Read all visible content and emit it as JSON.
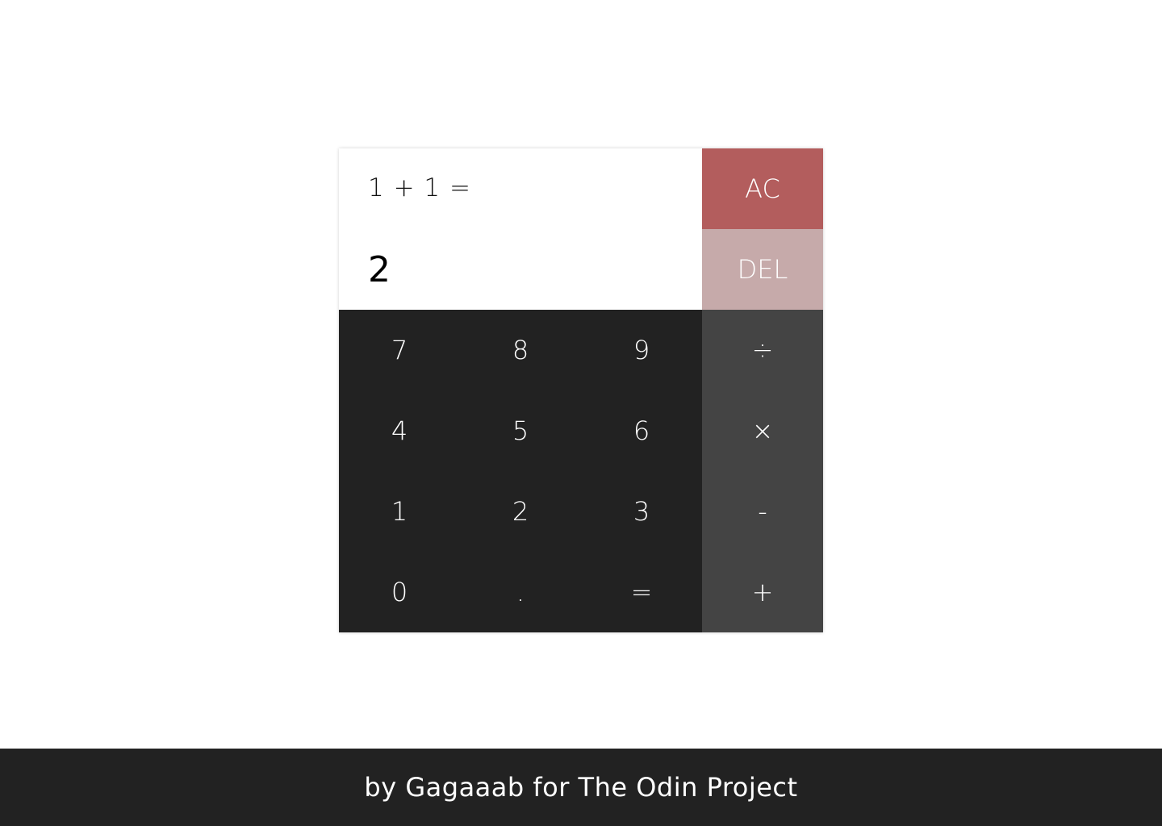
{
  "display": {
    "previous": "1 + 1 =",
    "current": "2"
  },
  "keys": {
    "ac": "AC",
    "del": "DEL",
    "seven": "7",
    "eight": "8",
    "nine": "9",
    "divide": "÷",
    "four": "4",
    "five": "5",
    "six": "6",
    "multiply": "×",
    "one": "1",
    "two": "2",
    "three": "3",
    "subtract": "-",
    "zero": "0",
    "decimal": ".",
    "equals": "=",
    "add": "+"
  },
  "footer": {
    "text": "by Gagaaab for The Odin Project"
  },
  "colors": {
    "number_key_bg": "#222222",
    "operator_key_bg": "#444444",
    "ac_key_bg": "#b35d5d",
    "del_key_bg": "#c6aaaa",
    "footer_bg": "#222222"
  }
}
